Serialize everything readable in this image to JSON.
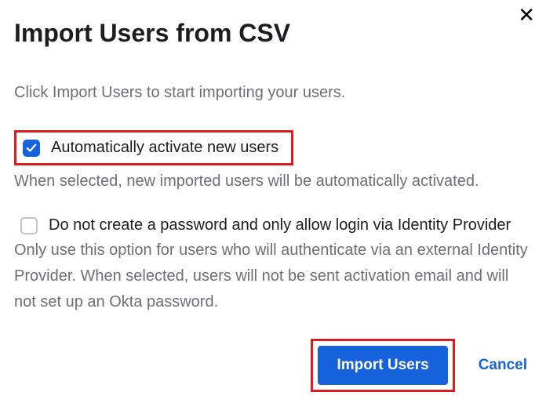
{
  "dialog": {
    "title": "Import Users from CSV",
    "instruction": "Click Import Users to start importing your users."
  },
  "options": {
    "auto_activate": {
      "label": "Automatically activate new users",
      "checked": true,
      "help": "When selected, new imported users will be automatically activated."
    },
    "no_password": {
      "label": "Do not create a password and only allow login via Identity Provider",
      "checked": false,
      "help": "Only use this option for users who will authenticate via an external Identity Provider. When selected, users will not be sent activation email and will not set up an Okta password."
    }
  },
  "actions": {
    "primary": "Import Users",
    "cancel": "Cancel"
  }
}
